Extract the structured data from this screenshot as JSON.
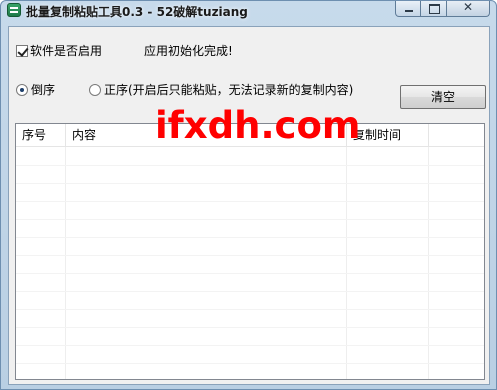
{
  "window": {
    "title": "批量复制粘贴工具0.3 - 52破解tuziang",
    "close_glyph": "✕"
  },
  "options": {
    "enable_checkbox_label": "软件是否启用",
    "enable_checked": true,
    "status_text": "应用初始化完成!",
    "order_options": [
      {
        "label": "倒序",
        "selected": true
      },
      {
        "label": "正序(开启后只能粘贴，无法记录新的复制内容)",
        "selected": false
      }
    ],
    "clear_button_label": "清空"
  },
  "list": {
    "columns": [
      "序号",
      "内容",
      "复制时间"
    ],
    "rows": []
  },
  "watermark": "ifxdh.com",
  "colors": {
    "watermark": "#ff0000",
    "titlebar": "#c7daeb"
  }
}
